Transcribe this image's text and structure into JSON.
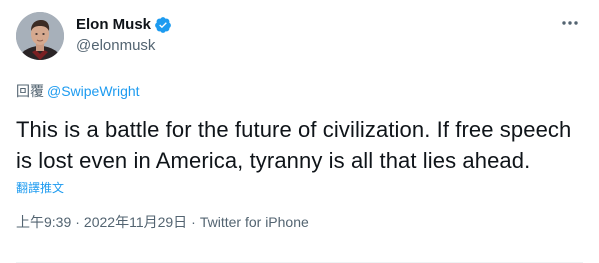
{
  "author": {
    "display_name": "Elon Musk",
    "handle": "@elonmusk",
    "verified": true
  },
  "reply": {
    "prefix": "回覆",
    "to": "@SwipeWright"
  },
  "tweet": {
    "text": "This is a battle for the future of civilization. If free speech is lost even in America, tyranny is all that lies ahead.",
    "translate_label": "翻譯推文"
  },
  "meta": {
    "time": "上午9:39",
    "separator": "·",
    "date": "2022年11月29日",
    "source": "Twitter for iPhone"
  },
  "icons": {
    "verified": "verified-badge-icon",
    "more": "more-options-icon"
  },
  "colors": {
    "accent": "#1d9bf0",
    "text": "#0f1419",
    "secondary": "#536471"
  }
}
